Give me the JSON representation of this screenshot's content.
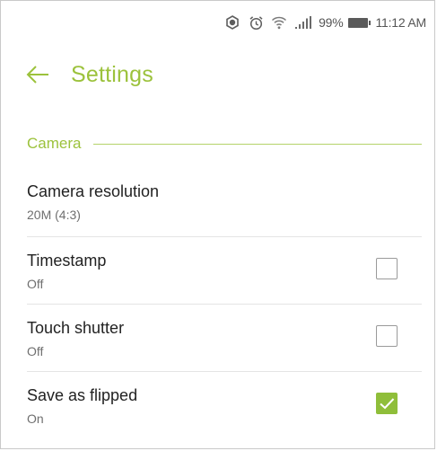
{
  "status_bar": {
    "battery_percent": "99%",
    "time": "11:12 AM"
  },
  "header": {
    "title": "Settings"
  },
  "section": {
    "title": "Camera"
  },
  "settings": [
    {
      "title": "Camera resolution",
      "value": "20M (4:3)"
    },
    {
      "title": "Timestamp",
      "value": "Off",
      "checked": false
    },
    {
      "title": "Touch shutter",
      "value": "Off",
      "checked": false
    },
    {
      "title": "Save as flipped",
      "value": "On",
      "checked": true
    }
  ],
  "colors": {
    "accent": "#9cc23c",
    "checkbox_checked": "#8fbe3a"
  }
}
